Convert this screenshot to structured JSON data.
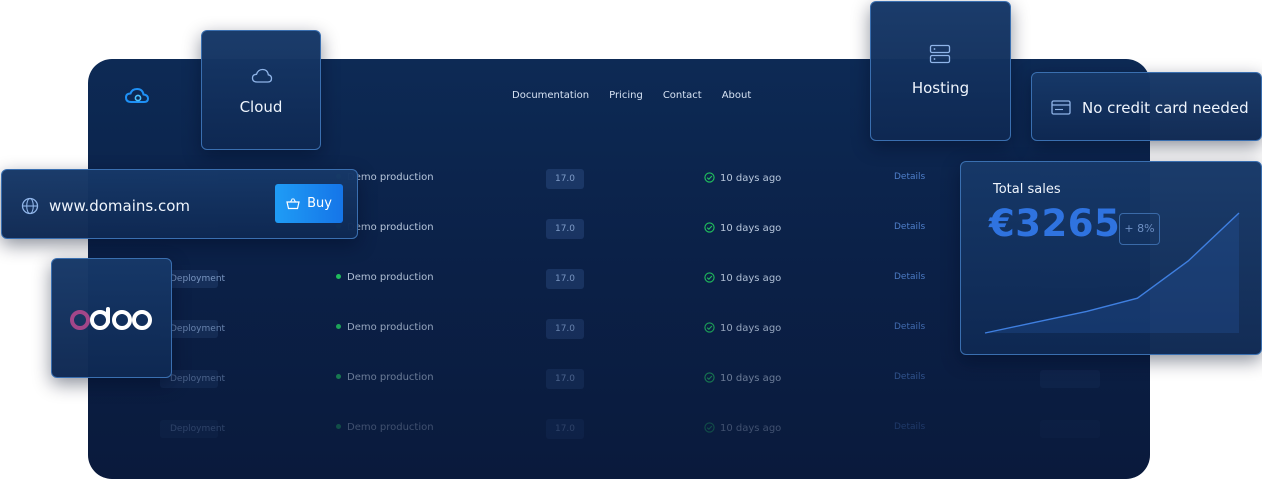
{
  "nav": {
    "items": [
      "Documentation",
      "Pricing",
      "Contact",
      "About"
    ]
  },
  "rows": [
    {
      "tag": "",
      "production": "Demo production",
      "version": "17.0",
      "ago": "10 days ago",
      "details": "Details"
    },
    {
      "tag": "",
      "production": "Demo production",
      "version": "17.0",
      "ago": "10 days ago",
      "details": "Details"
    },
    {
      "tag": "Deployment",
      "production": "Demo production",
      "version": "17.0",
      "ago": "10 days ago",
      "details": "Details"
    },
    {
      "tag": "Deployment",
      "production": "Demo production",
      "version": "17.0",
      "ago": "10 days ago",
      "details": "Details"
    },
    {
      "tag": "Deployment",
      "production": "Demo production",
      "version": "17.0",
      "ago": "10 days ago",
      "details": "Details"
    },
    {
      "tag": "Deployment",
      "production": "Demo production",
      "version": "17.0",
      "ago": "10 days ago",
      "details": "Details"
    }
  ],
  "cards": {
    "cloud": {
      "label": "Cloud"
    },
    "hosting": {
      "label": "Hosting"
    },
    "no_credit": {
      "label": "No credit card needed"
    },
    "domain": {
      "label": "www.domains.com",
      "buy_label": "Buy"
    },
    "sales": {
      "title": "Total sales",
      "amount": "€3265",
      "change": "+ 8%"
    }
  },
  "colors": {
    "accent": "#1f8cf2",
    "status_green": "#22c55e",
    "odoo_purple": "#a24689",
    "odoo_white": "#ffffff",
    "amount_blue": "#2f73e0"
  },
  "icons": {
    "brand": "cloud-logo-icon",
    "cloud": "cloud-icon",
    "hosting": "server-icon",
    "no_credit": "credit-card-icon",
    "domain": "globe-icon",
    "buy": "basket-icon",
    "status": "check-circle-icon"
  },
  "sales_trend": [
    0,
    0.09,
    0.18,
    0.29,
    0.6,
    1
  ]
}
